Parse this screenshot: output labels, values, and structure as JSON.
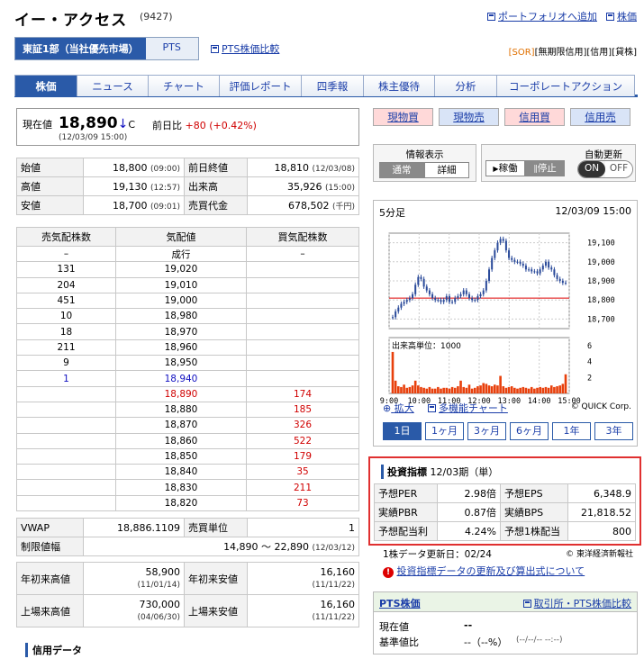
{
  "header": {
    "title": "イー・アクセス",
    "code": "(9427)",
    "link_portfolio": "ポートフォリオへ追加",
    "link_stock": "株価"
  },
  "market": {
    "primary": "東証1部（当社優先市場）",
    "pts": "PTS",
    "pts_compare": "PTS株価比較"
  },
  "badges": {
    "sor": "[SOR]",
    "unlimited": "[無期限信用]",
    "credit": "[信用]",
    "loan": "[貸株]"
  },
  "nav": [
    "株価",
    "ニュース",
    "チャート",
    "評価レポート",
    "四季報",
    "株主優待",
    "分析",
    "コーポレートアクション"
  ],
  "price": {
    "label": "現在値",
    "value": "18,890",
    "arrow": "↓",
    "suffix": "C",
    "time": "(12/03/09 15:00)",
    "change_label": "前日比",
    "change": "+80",
    "change_pct": "(+0.42%)"
  },
  "summary": [
    {
      "l": "始値",
      "v": "18,800",
      "t": "(09:00)",
      "l2": "前日終値",
      "v2": "18,810",
      "t2": "(12/03/08)"
    },
    {
      "l": "高値",
      "v": "19,130",
      "t": "(12:57)",
      "l2": "出来高",
      "v2": "35,926",
      "t2": "(15:00)"
    },
    {
      "l": "安値",
      "v": "18,700",
      "t": "(09:01)",
      "l2": "売買代金",
      "v2": "678,502",
      "t2": "(千円)"
    }
  ],
  "board": {
    "headers": [
      "売気配株数",
      "気配値",
      "買気配株数"
    ],
    "rows": [
      {
        "sell": "–",
        "price": "成行",
        "buy": "–"
      },
      {
        "sell": "131",
        "price": "19,020",
        "buy": ""
      },
      {
        "sell": "204",
        "price": "19,010",
        "buy": ""
      },
      {
        "sell": "451",
        "price": "19,000",
        "buy": ""
      },
      {
        "sell": "10",
        "price": "18,980",
        "buy": ""
      },
      {
        "sell": "18",
        "price": "18,970",
        "buy": ""
      },
      {
        "sell": "211",
        "price": "18,960",
        "buy": ""
      },
      {
        "sell": "9",
        "price": "18,950",
        "buy": ""
      },
      {
        "sell": "1",
        "price": "18,940",
        "buy": ""
      },
      {
        "sell": "",
        "price": "18,890",
        "buy": "174"
      },
      {
        "sell": "",
        "price": "18,880",
        "buy": "185"
      },
      {
        "sell": "",
        "price": "18,870",
        "buy": "326"
      },
      {
        "sell": "",
        "price": "18,860",
        "buy": "522"
      },
      {
        "sell": "",
        "price": "18,850",
        "buy": "179"
      },
      {
        "sell": "",
        "price": "18,840",
        "buy": "35"
      },
      {
        "sell": "",
        "price": "18,830",
        "buy": "211"
      },
      {
        "sell": "",
        "price": "18,820",
        "buy": "73"
      }
    ]
  },
  "vwap": {
    "label": "VWAP",
    "value": "18,886.1109",
    "unit_label": "売買単位",
    "unit": "1"
  },
  "limit": {
    "label": "制限値幅",
    "value": "14,890 〜 22,890",
    "date": "(12/03/12)"
  },
  "ytd": {
    "hi_label": "年初来高値",
    "hi": "58,900",
    "hi_date": "(11/01/14)",
    "lo_label": "年初来安値",
    "lo": "16,160",
    "lo_date": "(11/11/22)"
  },
  "listing": {
    "hi_label": "上場来高値",
    "hi": "730,000",
    "hi_date": "(04/06/30)",
    "lo_label": "上場来安値",
    "lo": "16,160",
    "lo_date": "(11/11/22)"
  },
  "credit_heading": "信用データ",
  "trade_buttons": [
    "現物買",
    "現物売",
    "信用買",
    "信用売"
  ],
  "info_display": {
    "title": "情報表示",
    "normal": "通常",
    "detail": "詳細"
  },
  "auto_update": {
    "title": "自動更新",
    "run": "稼働",
    "stop": "停止",
    "on": "ON",
    "off": "OFF"
  },
  "chart": {
    "interval": "5分足",
    "datetime": "12/03/09 15:00",
    "volume_label": "出来高単位：1000",
    "enlarge": "拡大",
    "multi": "多機能チャート",
    "credit": "© QUICK Corp.",
    "periods": [
      "1日",
      "1ヶ月",
      "3ヶ月",
      "6ヶ月",
      "1年",
      "3年"
    ]
  },
  "chart_data": {
    "type": "candlestick",
    "x_ticks": [
      "9:00",
      "10:00",
      "11:00",
      "12:00",
      "13:00",
      "14:00",
      "15:00"
    ],
    "y_ticks": [
      "19,100",
      "19,000",
      "18,900",
      "18,800",
      "18,700"
    ],
    "ylim": [
      18650,
      19150
    ],
    "reference_line": 18810,
    "volume_ticks": [
      "6",
      "4",
      "2"
    ],
    "volume_ylim": [
      0,
      7
    ],
    "grid": true,
    "series": [
      {
        "name": "price",
        "values": [
          18710,
          18740,
          18760,
          18780,
          18790,
          18800,
          18810,
          18830,
          18880,
          18920,
          18910,
          18870,
          18850,
          18830,
          18810,
          18800,
          18800,
          18790,
          18800,
          18820,
          18790,
          18790,
          18810,
          18820,
          18830,
          18850,
          18830,
          18810,
          18800,
          18800,
          18820,
          18830,
          18850,
          18900,
          18960,
          19020,
          19060,
          19100,
          19120,
          19110,
          19060,
          19020,
          19010,
          19000,
          19000,
          18990,
          18980,
          18960,
          18960,
          18950,
          18950,
          18940,
          18960,
          18980,
          19000,
          18970,
          18960,
          18930,
          18910,
          18900,
          18890,
          18890
        ]
      },
      {
        "name": "volume",
        "values": [
          5.2,
          1.6,
          0.9,
          0.8,
          1.1,
          0.7,
          0.8,
          1.0,
          1.6,
          1.0,
          0.8,
          0.7,
          0.6,
          0.8,
          0.6,
          0.6,
          0.8,
          0.6,
          0.7,
          0.7,
          0.6,
          0.8,
          0.7,
          0.9,
          1.6,
          0.8,
          0.7,
          1.1,
          0.6,
          0.7,
          0.9,
          1.0,
          1.3,
          1.2,
          1.0,
          0.9,
          1.1,
          1.0,
          2.2,
          0.9,
          0.7,
          0.8,
          0.9,
          0.7,
          0.6,
          0.7,
          0.8,
          0.7,
          0.6,
          0.8,
          0.6,
          0.7,
          0.8,
          0.7,
          0.8,
          0.7,
          1.0,
          0.8,
          0.9,
          1.0,
          1.2,
          2.4
        ]
      }
    ]
  },
  "indicators": {
    "title": "投資指標",
    "period": "12/03期（単）",
    "rows": [
      {
        "l": "予想PER",
        "v": "2.98倍",
        "l2": "予想EPS",
        "v2": "6,348.9"
      },
      {
        "l": "実績PBR",
        "v": "0.87倍",
        "l2": "実績BPS",
        "v2": "21,818.52"
      },
      {
        "l": "予想配当利",
        "v": "4.24%",
        "l2": "予想1株配当",
        "v2": "800"
      }
    ],
    "update": "1株データ更新日：02/24",
    "source": "© 東洋経済新報社",
    "notice": "投資指標データの更新及び算出式について"
  },
  "pts": {
    "title": "PTS株価",
    "compare": "取引所・PTS株価比較",
    "now_label": "現在値",
    "now": "--",
    "base_label": "基準値比",
    "base": "--（--%）",
    "base_time": "(--/--/-- --:--)"
  }
}
